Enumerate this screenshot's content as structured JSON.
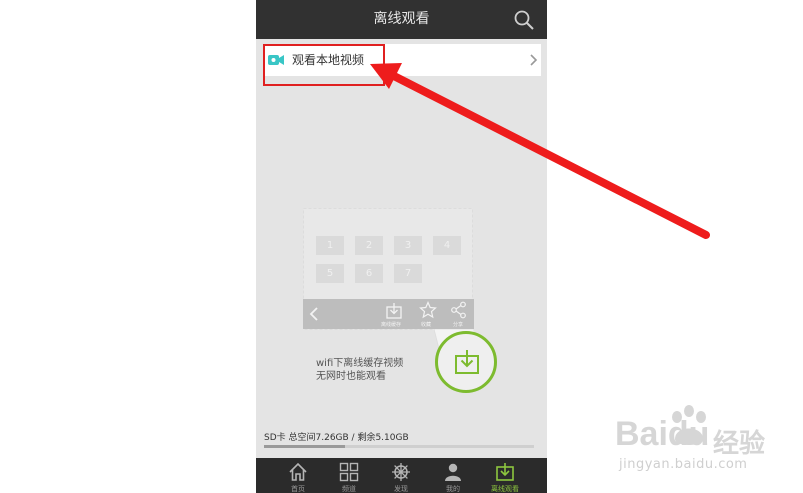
{
  "header": {
    "title": "离线观看"
  },
  "local_video_row": {
    "label": "观看本地视频"
  },
  "illustration": {
    "grid": [
      "1",
      "2",
      "3",
      "4",
      "5",
      "6",
      "7"
    ],
    "toolbar_labels": [
      "离线缓存",
      "收藏",
      "分享"
    ]
  },
  "promo": {
    "line1": "wifi下离线缓存视频",
    "line2": "无网时也能观看"
  },
  "storage": {
    "text": "SD卡 总空间7.26GB / 剩余5.10GB",
    "used_fraction": 0.3
  },
  "tabs": [
    {
      "label": "首页",
      "icon": "home-icon"
    },
    {
      "label": "频道",
      "icon": "grid-icon"
    },
    {
      "label": "发现",
      "icon": "ship-wheel-icon"
    },
    {
      "label": "我的",
      "icon": "user-icon"
    },
    {
      "label": "离线观看",
      "icon": "download-icon",
      "active": true
    }
  ],
  "watermark": {
    "brand": "Baidu",
    "brand_cn": "经验",
    "url": "jingyan.baidu.com"
  },
  "colors": {
    "accent": "#8dc63f",
    "annotation": "#e02020",
    "topbar": "#313131"
  }
}
